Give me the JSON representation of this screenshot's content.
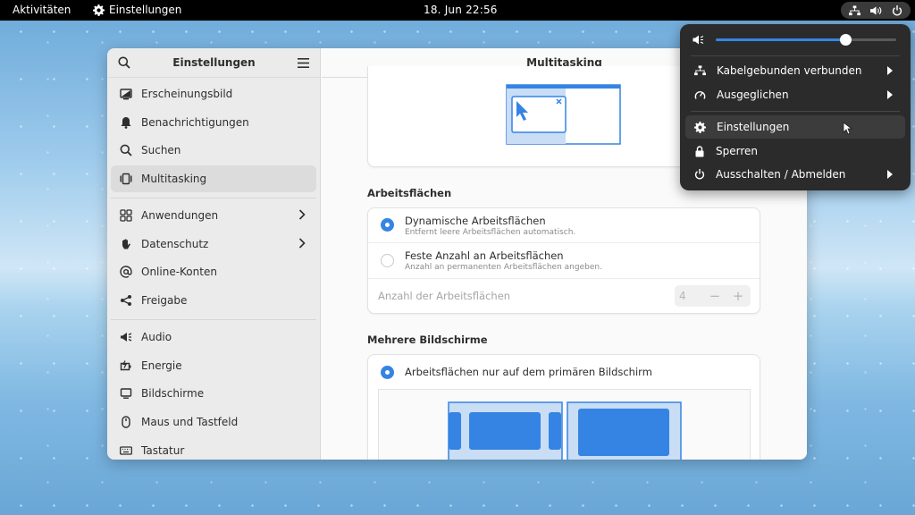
{
  "topbar": {
    "activities": "Aktivitäten",
    "app_name": "Einstellungen",
    "clock": "18. Jun  22:56"
  },
  "sidebar": {
    "title": "Einstellungen",
    "items": [
      {
        "label": "Erscheinungsbild",
        "icon": "appearance-icon"
      },
      {
        "label": "Benachrichtigungen",
        "icon": "bell-icon"
      },
      {
        "label": "Suchen",
        "icon": "search-icon"
      },
      {
        "label": "Multitasking",
        "icon": "multitasking-icon"
      },
      {
        "label": "Anwendungen",
        "icon": "apps-grid-icon"
      },
      {
        "label": "Datenschutz",
        "icon": "hand-icon"
      },
      {
        "label": "Online-Konten",
        "icon": "at-icon"
      },
      {
        "label": "Freigabe",
        "icon": "share-icon"
      },
      {
        "label": "Audio",
        "icon": "speaker-icon"
      },
      {
        "label": "Energie",
        "icon": "battery-icon"
      },
      {
        "label": "Bildschirme",
        "icon": "monitor-icon"
      },
      {
        "label": "Maus und Tastfeld",
        "icon": "mouse-icon"
      },
      {
        "label": "Tastatur",
        "icon": "keyboard-icon"
      }
    ]
  },
  "main": {
    "title": "Multitasking",
    "workspaces": {
      "heading": "Arbeitsflächen",
      "dynamic_title": "Dynamische Arbeitsflächen",
      "dynamic_sub": "Entfernt leere Arbeitsflächen automatisch.",
      "fixed_title": "Feste Anzahl an Arbeitsflächen",
      "fixed_sub": "Anzahl an permanenten Arbeitsflächen angeben.",
      "count_label": "Anzahl der Arbeitsflächen",
      "count_value": "4",
      "minus": "−",
      "plus": "+"
    },
    "multi_monitor": {
      "heading": "Mehrere Bildschirme",
      "primary_only": "Arbeitsflächen nur auf dem primären Bildschirm"
    }
  },
  "quick_menu": {
    "volume_level": 0.72,
    "items": [
      {
        "label": "Kabelgebunden verbunden",
        "icon": "network-icon",
        "submenu": true
      },
      {
        "label": "Ausgeglichen",
        "icon": "power-mode-icon",
        "submenu": true
      },
      {
        "label": "Einstellungen",
        "icon": "gear-icon",
        "submenu": false
      },
      {
        "label": "Sperren",
        "icon": "lock-icon",
        "submenu": false
      },
      {
        "label": "Ausschalten / Abmelden",
        "icon": "power-icon",
        "submenu": true
      }
    ]
  },
  "colors": {
    "accent": "#3584e4",
    "menu_bg": "#2b2b2b",
    "topbar_bg": "#000000"
  }
}
